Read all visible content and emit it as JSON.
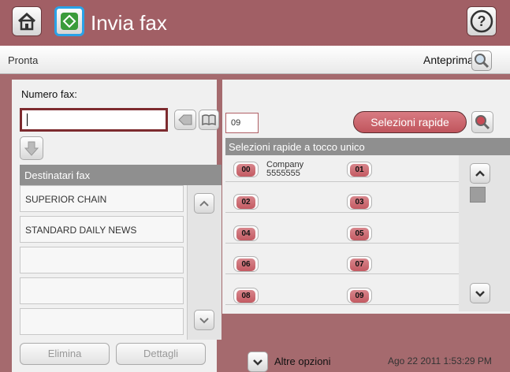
{
  "header": {
    "title": "Invia fax"
  },
  "status_bar": {
    "status": "Pronta",
    "preview_label": "Anteprima"
  },
  "left_panel": {
    "fax_number_label": "Numero fax:",
    "fax_number_value": "",
    "recipients_header": "Destinatari fax",
    "recipients": [
      "SUPERIOR CHAIN",
      "STANDARD DAILY NEWS",
      "",
      "",
      ""
    ],
    "delete_label": "Elimina",
    "details_label": "Dettagli"
  },
  "right_panel": {
    "speed_dial_code": "09",
    "speed_dials_button": "Selezioni rapide",
    "speed_dials_header": "Selezioni rapide a tocco unico",
    "entries": [
      {
        "code": "00",
        "name": "Company",
        "number": "5555555"
      },
      {
        "code": "01"
      },
      {
        "code": "02"
      },
      {
        "code": "03"
      },
      {
        "code": "04"
      },
      {
        "code": "05"
      },
      {
        "code": "06"
      },
      {
        "code": "07"
      },
      {
        "code": "08"
      },
      {
        "code": "09"
      }
    ]
  },
  "footer": {
    "more_options_label": "Altre opzioni",
    "datetime": "Ago 22 2011 1:53:29 PM"
  },
  "icons": {
    "home": "home-icon",
    "start": "start-icon",
    "help": "help-icon",
    "preview": "magnifier-icon",
    "backspace": "backspace-icon",
    "address_book": "address-book-icon",
    "add": "arrow-down-icon",
    "scroll_up": "chevron-up-icon",
    "scroll_down": "chevron-down-icon"
  },
  "colors": {
    "title_bar": "#a15f65",
    "accent_button": "#c0555d",
    "start_border": "#2aa2e8"
  }
}
